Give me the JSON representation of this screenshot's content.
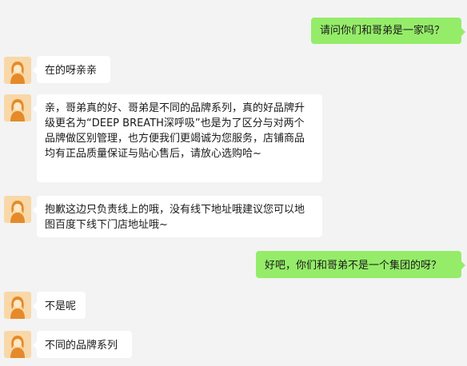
{
  "messages": [
    {
      "side": "out",
      "text": "请问你们和哥弟是一家吗？"
    },
    {
      "side": "in",
      "text": "在的呀亲亲"
    },
    {
      "side": "in",
      "text": "亲，哥弟真的好、哥弟是不同的品牌系列，真的好品牌升级更名为“DEEP BREATH深呼吸”也是为了区分与对两个品牌做区别管理，也方便我们更竭诚为您服务，店铺商品均有正品质量保证与贴心售后，请放心选购哈~"
    },
    {
      "side": "in",
      "text": "抱歉这边只负责线上的哦，没有线下地址哦建议您可以地图百度下线下门店地址哦~"
    },
    {
      "side": "out",
      "text": "好吧，你们和哥弟不是一个集团的呀？"
    },
    {
      "side": "in",
      "text": "不是呢"
    },
    {
      "side": "in",
      "text": "不同的品牌系列"
    }
  ],
  "icons": {
    "agent_avatar": "female-silhouette-avatar-icon"
  },
  "colors": {
    "background": "#f3f3f3",
    "outgoing_bubble": "#95ec69",
    "incoming_bubble": "#ffffff",
    "avatar_bg": "#f8d8a8",
    "avatar_figure": "#e58a2a"
  }
}
